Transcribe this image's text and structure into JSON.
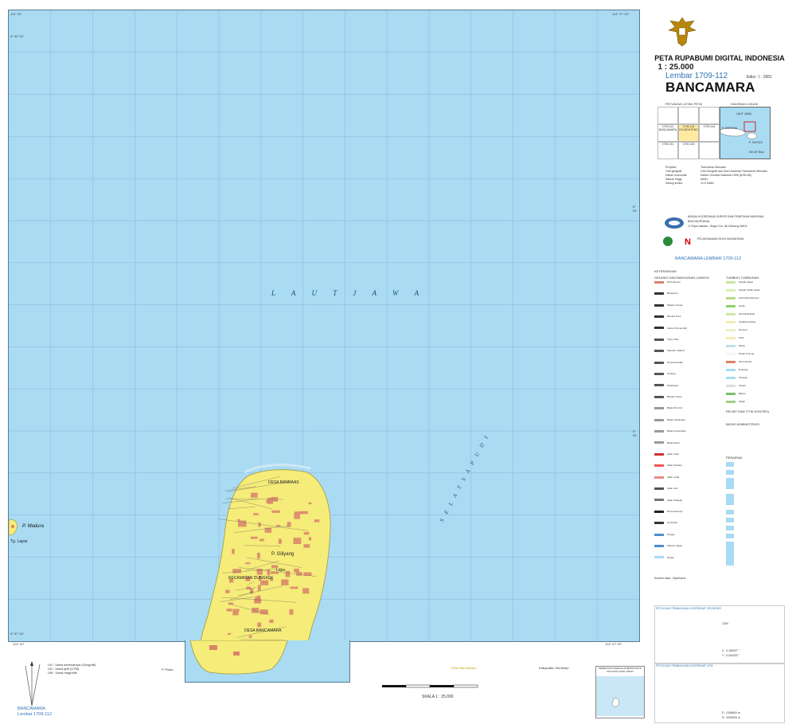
{
  "map": {
    "sea_label": "L A U T   J A W A",
    "strait_label": "S E L A T   S A P U D I",
    "island_madura": "P. Madura",
    "island_madura_sub": "Tg. Lapar",
    "place_gilyang": "P. Giliyang",
    "place_banraas": "DESA BANRAAS",
    "place_kecamatan": "KECAMATAN DUNGKEK",
    "place_bancamara": "DESA BANCAMARA",
    "place_lapa": "Lapa",
    "coord_top_left": "114° 00'",
    "coord_top_right": "114° 07' 30\"",
    "coord_bottom_left": "114° 00'",
    "coord_bottom_right": "114° 07' 30\"",
    "coord_left_top": "6° 50' 00\"",
    "coord_left_bottom": "6° 57' 30\"",
    "coord_right_mid1": "6° 55'",
    "coord_right_mid2": "6° 52'"
  },
  "legend": {
    "title": "PETA RUPABUMI DIGITAL INDONESIA",
    "scale": "1 : 25.000",
    "sheet": "Lembar 1709-112",
    "edition": "Edisi : I - 2001",
    "name": "BANCAMARA",
    "index_title": "PETUNJUK LETAK PETA",
    "region_title": "DIAGRAM LOKASI",
    "region_labels": [
      "LAUT JAWA",
      "P. MADURA",
      "P. SAPUDI",
      "SELAT BALI"
    ],
    "index_cells": [
      "1709-112 BANCAMARA",
      "1709-113 GILIGENTENG",
      "1709-144",
      "1709-141",
      "1709-143"
    ],
    "info_rows": [
      [
        "Proyeksi",
        "Transverse Mercator"
      ],
      [
        "Grid geografi",
        "Grid Geografi dan Grid Universal Transverse Mercator"
      ],
      [
        "Datum horisontal",
        "Datum Geodesi Nasional 1995 (DGN-95)"
      ],
      [
        "Satuan tinggi",
        "Meter"
      ],
      [
        "Selang kontur",
        "12,5 meter"
      ]
    ],
    "agency1": "BADAN KOORDINASI SURVEI DAN PEMETAAN NASIONAL",
    "agency2": "BAKOSURTANAL",
    "agency_addr": "Jl. Raya Jakarta - Bogor Km. 46 Cibinong 16911",
    "partner": "PELAKSANAAN OLEH NUSANTARA",
    "strip": "BANCAMARA LEMBAR 1709-112",
    "keterangan": "KETERANGAN",
    "col1_head": "GEDUNG DAN BANGUNAN LAINNYA",
    "col2_head": "TUMBUH-TUMBUHAN",
    "col1_items": [
      "Permukiman",
      "Bangunan",
      "Masjid, Gereja",
      "Menara Pura",
      "Kantor Pemerintah",
      "Tugu, Pilar",
      "Sekolah, Makam",
      "Tempat Ibadah",
      "Gudang",
      "Pelabuhan",
      "Bandar Udara",
      "Batas Provinsi",
      "Batas Kabupaten",
      "Batas Kecamatan",
      "Batas Desa",
      "Jalan Arteri",
      "Jalan Kolektor",
      "Jalan Lokal",
      "Jalan Lain",
      "Jalan Setapak",
      "Rel Kereta Api",
      "Jembatan",
      "Sungai",
      "Saluran Irigasi",
      "Danau"
    ],
    "col2_items": [
      "Sawah Irigasi",
      "Sawah Tadah Hujan",
      "Kebun/Perkebunan",
      "Hutan",
      "Semak Belukar",
      "Tegalan/Ladang",
      "Rumput",
      "Pasir",
      "Rawa",
      "Tanah Kosong",
      "Permukiman",
      "Empang",
      "Tambak",
      "Garam",
      "Bakau",
      "Nipah"
    ],
    "col2_head2": "RELIEF DAN TITIK KONTROL",
    "col2_head3": "BATAS ADMINISTRASI",
    "col2_head4": "PERAIRAN",
    "bottom_blue1": "PETUNJUK PEMBACAAN KOORDINAT GEOGRAFI",
    "bottom_blue2": "PETUNJUK PEMBACAAN KOORDINAT UTM",
    "grid_val1": "1200",
    "grid_val2": "X : 0,184927 °",
    "grid_val3": "Y : 0,034323 °",
    "utm_e": "E : 0198600 m",
    "utm_n": "N : 9233400 m"
  },
  "bottom": {
    "sheet_name": "BANCAMARA",
    "sheet_num": "Lembar 1709-112",
    "scale_label": "SKALA 1 : 25.000",
    "diagram_title": "PEMBAGIAN DAERAH ADMINISTRATIF PROVINSI JAWA TIMUR",
    "legend_small": "P. Pulau",
    "north_notes": [
      "UG : Utara sebenarnya (Geografi)",
      "UG : Utara grid (UTM)",
      "UM : Utara magnetik"
    ],
    "yellow_note": "Desa Bancamara",
    "admin_note": "Kabupaten Sumenep"
  },
  "colors": {
    "sea": "#a9dbf3",
    "land": "#f5ec7a",
    "built": "#d9836a",
    "grid": "#7aa9d6",
    "accent": "#2d74b5"
  }
}
